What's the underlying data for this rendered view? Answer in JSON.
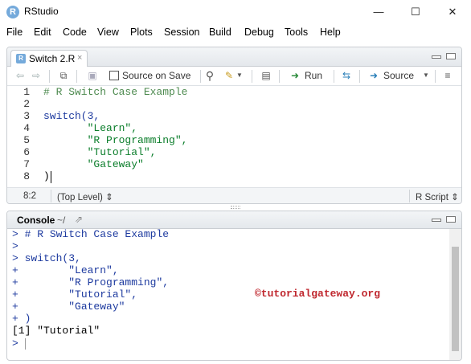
{
  "window": {
    "title": "RStudio",
    "minimize": "—",
    "maximize": "☐",
    "close": "✕"
  },
  "menu": [
    "File",
    "Edit",
    "Code",
    "View",
    "Plots",
    "Session",
    "Build",
    "Debug",
    "Tools",
    "Help"
  ],
  "source": {
    "tab_label": "Switch 2.R",
    "tab_close": "×",
    "source_on_save": "Source on Save",
    "run_label": "Run",
    "source_label": "Source",
    "lines": [
      {
        "num": "1",
        "text": "# R Switch Case Example"
      },
      {
        "num": "2",
        "text": ""
      },
      {
        "num": "3",
        "text": "switch(3,"
      },
      {
        "num": "4",
        "text": "       \"Learn\","
      },
      {
        "num": "5",
        "text": "       \"R Programming\","
      },
      {
        "num": "6",
        "text": "       \"Tutorial\","
      },
      {
        "num": "7",
        "text": "       \"Gateway\""
      },
      {
        "num": "8",
        "text": ")"
      }
    ],
    "status": {
      "position": "8:2",
      "scope": "(Top Level) ⇕",
      "filetype": "R Script ⇕"
    }
  },
  "console": {
    "title": "Console",
    "path": "~/",
    "lines": [
      {
        "prompt": ">",
        "text": " # R Switch Case Example"
      },
      {
        "prompt": ">",
        "text": ""
      },
      {
        "prompt": ">",
        "text": " switch(3,"
      },
      {
        "prompt": "+",
        "text": "        \"Learn\","
      },
      {
        "prompt": "+",
        "text": "        \"R Programming\","
      },
      {
        "prompt": "+",
        "text": "        \"Tutorial\","
      },
      {
        "prompt": "+",
        "text": "        \"Gateway\""
      },
      {
        "prompt": "+",
        "text": " )"
      },
      {
        "prompt": "",
        "text": "[1] \"Tutorial\""
      },
      {
        "prompt": ">",
        "text": ""
      }
    ],
    "watermark": "©tutorialgateway.org"
  }
}
